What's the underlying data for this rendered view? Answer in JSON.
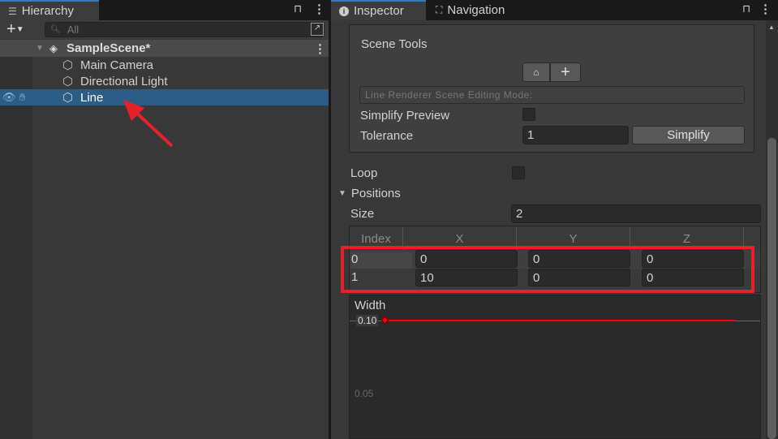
{
  "hierarchy": {
    "tab_label": "Hierarchy",
    "search_placeholder": "All",
    "scene": {
      "name": "SampleScene*"
    },
    "items": [
      {
        "label": "Main Camera"
      },
      {
        "label": "Directional Light"
      },
      {
        "label": "Line",
        "selected": true
      }
    ]
  },
  "inspector": {
    "tabs": [
      {
        "label": "Inspector",
        "active": true
      },
      {
        "label": "Navigation"
      }
    ],
    "scene_tools": {
      "title": "Scene Tools",
      "mode_label": "Line Renderer Scene Editing Mode:",
      "simplify_preview_label": "Simplify Preview",
      "simplify_preview_checked": false,
      "tolerance_label": "Tolerance",
      "tolerance_value": "1",
      "simplify_button": "Simplify"
    },
    "loop_label": "Loop",
    "loop_checked": false,
    "positions_label": "Positions",
    "size_label": "Size",
    "size_value": "2",
    "table": {
      "headers": [
        "Index",
        "X",
        "Y",
        "Z"
      ],
      "rows": [
        {
          "index": "0",
          "x": "0",
          "y": "0",
          "z": "0"
        },
        {
          "index": "1",
          "x": "10",
          "y": "0",
          "z": "0"
        }
      ]
    },
    "width": {
      "label": "Width",
      "tick_top": "0.10",
      "tick_mid": "0.05",
      "curve_color": "#ff0000"
    }
  },
  "annotation_color": "#e8202a"
}
